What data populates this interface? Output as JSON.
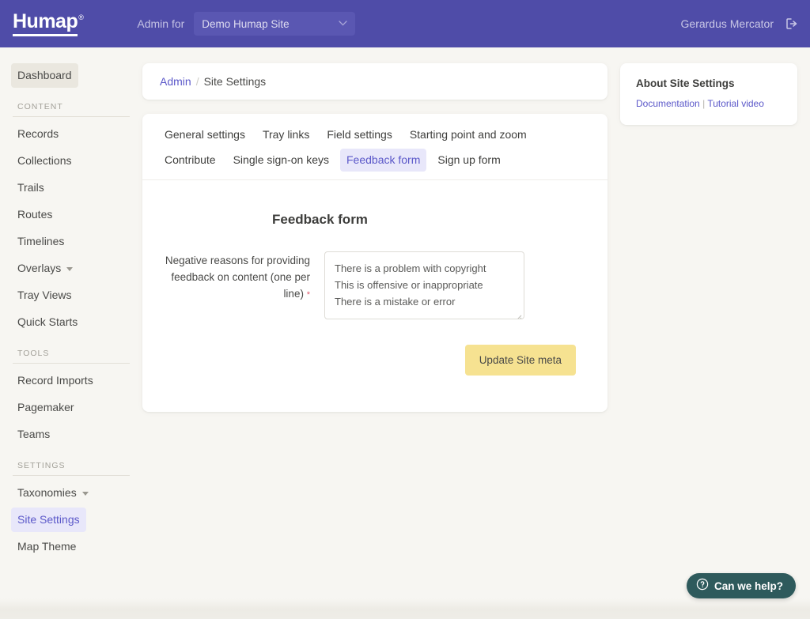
{
  "header": {
    "logo_text": "Humap",
    "logo_mark": "®",
    "admin_for_label": "Admin for",
    "site_select_value": "Demo Humap Site",
    "site_select_caret": "chevron-down-icon",
    "user_name": "Gerardus Mercator",
    "logout_icon": "logout-icon"
  },
  "sidebar": {
    "dashboard_label": "Dashboard",
    "groups": [
      {
        "label": "CONTENT",
        "items": [
          {
            "label": "Records",
            "caret": false,
            "active": false
          },
          {
            "label": "Collections",
            "caret": false,
            "active": false
          },
          {
            "label": "Trails",
            "caret": false,
            "active": false
          },
          {
            "label": "Routes",
            "caret": false,
            "active": false
          },
          {
            "label": "Timelines",
            "caret": false,
            "active": false
          },
          {
            "label": "Overlays",
            "caret": true,
            "active": false
          },
          {
            "label": "Tray Views",
            "caret": false,
            "active": false
          },
          {
            "label": "Quick Starts",
            "caret": false,
            "active": false
          }
        ]
      },
      {
        "label": "TOOLS",
        "items": [
          {
            "label": "Record Imports",
            "caret": false,
            "active": false
          },
          {
            "label": "Pagemaker",
            "caret": false,
            "active": false
          },
          {
            "label": "Teams",
            "caret": false,
            "active": false
          }
        ]
      },
      {
        "label": "SETTINGS",
        "items": [
          {
            "label": "Taxonomies",
            "caret": true,
            "active": false
          },
          {
            "label": "Site Settings",
            "caret": false,
            "active": true
          },
          {
            "label": "Map Theme",
            "caret": false,
            "active": false
          }
        ]
      }
    ]
  },
  "breadcrumb": {
    "root": "Admin",
    "separator": "/",
    "current": "Site Settings"
  },
  "tabs": [
    {
      "label": "General settings",
      "active": false
    },
    {
      "label": "Tray links",
      "active": false
    },
    {
      "label": "Field settings",
      "active": false
    },
    {
      "label": "Starting point and zoom",
      "active": false
    },
    {
      "label": "Contribute",
      "active": false
    },
    {
      "label": "Single sign-on keys",
      "active": false
    },
    {
      "label": "Feedback form",
      "active": true
    },
    {
      "label": "Sign up form",
      "active": false
    }
  ],
  "form": {
    "title": "Feedback form",
    "field_label": "Negative reasons for providing feedback on content (one per line)",
    "required_mark": "*",
    "textarea_value": "There is a problem with copyright\nThis is offensive or inappropriate\nThere is a mistake or error",
    "textarea_placeholder": "",
    "submit_label": "Update Site meta"
  },
  "about": {
    "title": "About Site Settings",
    "doc_link": "Documentation",
    "link_separator": "|",
    "video_link": "Tutorial video"
  },
  "chat": {
    "icon": "question-circle-icon",
    "label": "Can we help?"
  },
  "colors": {
    "header_purple": "#4f4ca8",
    "accent_purple": "#5b58c9",
    "active_tab_bg": "#e8e7fa",
    "page_bg": "#f7f6f2",
    "button_yellow": "#f6e291",
    "chat_teal": "#2e5a5c",
    "required_red": "#e05a6e"
  }
}
